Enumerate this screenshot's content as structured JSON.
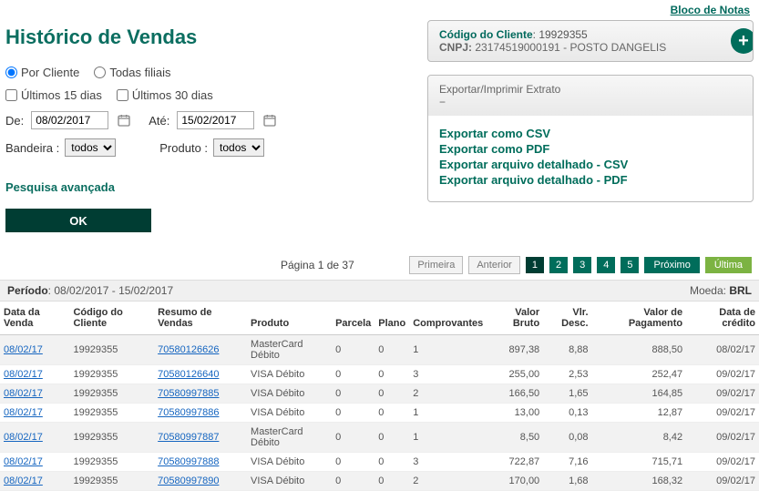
{
  "topbar": {
    "notas": "Bloco de Notas"
  },
  "title": "Histórico de Vendas",
  "radios": {
    "porCliente": "Por Cliente",
    "todasFiliais": "Todas filiais"
  },
  "checks": {
    "ult15": "Últimos 15 dias",
    "ult30": "Últimos 30 dias"
  },
  "dates": {
    "deLabel": "De:",
    "de": "08/02/2017",
    "ateLabel": "Até:",
    "ate": "15/02/2017"
  },
  "filters": {
    "bandeiraLabel": "Bandeira :",
    "bandeira": "todos",
    "produtoLabel": "Produto :",
    "produto": "todos"
  },
  "advanced": "Pesquisa avançada",
  "okLabel": "OK",
  "clientPanel": {
    "codLabel": "Código do Cliente",
    "codValue": "19929355",
    "cnpjLabel": "CNPJ:",
    "cnpjValue": "23174519000191 - POSTO DANGELIS"
  },
  "exportPanel": {
    "header": "Exportar/Imprimir Extrato",
    "links": {
      "csv": "Exportar como CSV",
      "pdf": "Exportar como PDF",
      "detCsv": "Exportar arquivo detalhado - CSV",
      "detPdf": "Exportar arquivo detalhado - PDF"
    }
  },
  "pager": {
    "info": "Página 1 de 37",
    "first": "Primeira",
    "prev": "Anterior",
    "p1": "1",
    "p2": "2",
    "p3": "3",
    "p4": "4",
    "p5": "5",
    "next": "Próximo",
    "last": "Última"
  },
  "meta": {
    "periodoLabel": "Período",
    "periodo": "08/02/2017 - 15/02/2017",
    "moedaLabel": "Moeda:",
    "moeda": "BRL"
  },
  "table": {
    "headers": {
      "dataVenda": "Data da Venda",
      "codCliente": "Código do Cliente",
      "resumo": "Resumo de Vendas",
      "produto": "Produto",
      "parcela": "Parcela",
      "plano": "Plano",
      "comprov": "Comprovantes",
      "bruto": "Valor Bruto",
      "desc": "Vlr. Desc.",
      "pagto": "Valor de Pagamento",
      "credito": "Data de crédito"
    },
    "rows": [
      {
        "dataVenda": "08/02/17",
        "codCliente": "19929355",
        "resumo": "70580126626",
        "produto": "MasterCard Débito",
        "parcela": "0",
        "plano": "0",
        "comprov": "1",
        "bruto": "897,38",
        "desc": "8,88",
        "pagto": "888,50",
        "credito": "08/02/17"
      },
      {
        "dataVenda": "08/02/17",
        "codCliente": "19929355",
        "resumo": "70580126640",
        "produto": "VISA Débito",
        "parcela": "0",
        "plano": "0",
        "comprov": "3",
        "bruto": "255,00",
        "desc": "2,53",
        "pagto": "252,47",
        "credito": "09/02/17"
      },
      {
        "dataVenda": "08/02/17",
        "codCliente": "19929355",
        "resumo": "70580997885",
        "produto": "VISA Débito",
        "parcela": "0",
        "plano": "0",
        "comprov": "2",
        "bruto": "166,50",
        "desc": "1,65",
        "pagto": "164,85",
        "credito": "09/02/17"
      },
      {
        "dataVenda": "08/02/17",
        "codCliente": "19929355",
        "resumo": "70580997886",
        "produto": "VISA Débito",
        "parcela": "0",
        "plano": "0",
        "comprov": "1",
        "bruto": "13,00",
        "desc": "0,13",
        "pagto": "12,87",
        "credito": "09/02/17"
      },
      {
        "dataVenda": "08/02/17",
        "codCliente": "19929355",
        "resumo": "70580997887",
        "produto": "MasterCard Débito",
        "parcela": "0",
        "plano": "0",
        "comprov": "1",
        "bruto": "8,50",
        "desc": "0,08",
        "pagto": "8,42",
        "credito": "09/02/17"
      },
      {
        "dataVenda": "08/02/17",
        "codCliente": "19929355",
        "resumo": "70580997888",
        "produto": "VISA Débito",
        "parcela": "0",
        "plano": "0",
        "comprov": "3",
        "bruto": "722,87",
        "desc": "7,16",
        "pagto": "715,71",
        "credito": "09/02/17"
      },
      {
        "dataVenda": "08/02/17",
        "codCliente": "19929355",
        "resumo": "70580997890",
        "produto": "VISA Débito",
        "parcela": "0",
        "plano": "0",
        "comprov": "2",
        "bruto": "170,00",
        "desc": "1,68",
        "pagto": "168,32",
        "credito": "09/02/17"
      }
    ]
  }
}
